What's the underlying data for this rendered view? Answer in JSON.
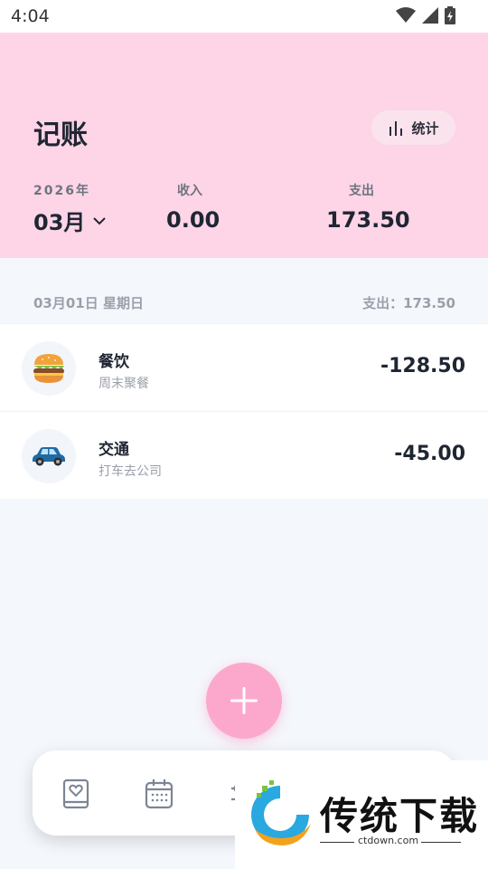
{
  "status_bar": {
    "time": "4:04",
    "icons": [
      "wifi-icon",
      "signal-icon",
      "battery-charging-icon"
    ]
  },
  "header": {
    "title": "记账",
    "stats_button_label": "统计",
    "stats_icon": "bar-chart-icon",
    "year": "2026年",
    "month": "03月",
    "income_label": "收入",
    "income_value": "0.00",
    "expense_label": "支出",
    "expense_value": "173.50",
    "background_color": "#fdd5e6"
  },
  "day_group": {
    "date": "03月01日 星期日",
    "total": "支出：173.50"
  },
  "transactions": [
    {
      "category": "餐饮",
      "note": "周末聚餐",
      "amount": "-128.50",
      "icon": "hamburger-icon"
    },
    {
      "category": "交通",
      "note": "打车去公司",
      "amount": "-45.00",
      "icon": "car-icon"
    }
  ],
  "fab": {
    "icon": "plus-icon",
    "color": "#fca8cc"
  },
  "bottom_nav": {
    "items": [
      "book-heart-icon",
      "calendar-icon",
      "settings-icon"
    ]
  },
  "watermark": {
    "text": "传统下载",
    "url": "ctdown.com"
  }
}
